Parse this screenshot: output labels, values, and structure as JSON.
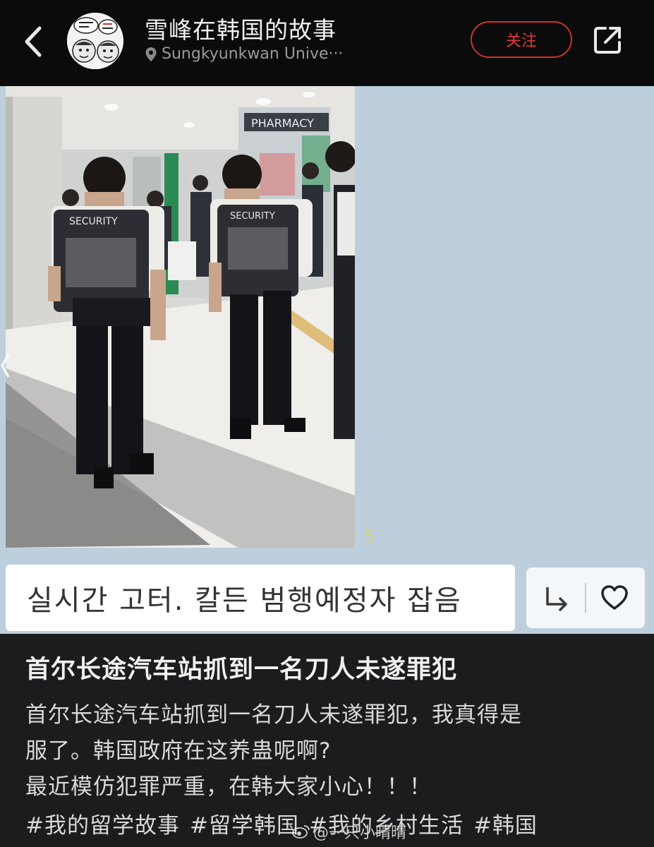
{
  "header": {
    "title": "雪峰在韩国的故事",
    "location": "Sungkyunkwan Unive···",
    "follow_label": "关注"
  },
  "photo": {
    "sign_text": "PHARMACY",
    "vest_text": "SECURITY",
    "count_badge": "5"
  },
  "chat": {
    "bubble_text": "실시간 고터.  칼든 범행예정자 잡음"
  },
  "post": {
    "title": "首尔长途汽车站抓到一名刀人未遂罪犯",
    "body_lines": [
      "首尔长途汽车站抓到一名刀人未遂罪犯，我真得是",
      "服了。韩国政府在这养蛊呢啊?",
      "最近模仿犯罪严重，在韩大家小心！！！"
    ],
    "tags": [
      "#我的留学故事",
      "#留学韩国",
      "#我的乡村生活",
      "#韩国"
    ]
  },
  "watermark": {
    "text": "@一只小晴晴"
  },
  "colors": {
    "header_bg": "#0b0b0b",
    "chat_bg": "#bdcfdd",
    "post_bg": "#1c1c1e",
    "follow_accent": "#d0302f"
  },
  "icons": [
    "back-chevron-icon",
    "location-pin-icon",
    "share-external-icon",
    "reply-arrow-icon",
    "heart-icon",
    "weibo-logo-icon"
  ]
}
